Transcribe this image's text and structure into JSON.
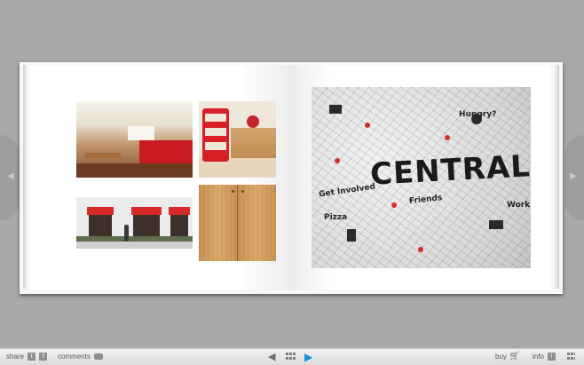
{
  "toolbar": {
    "share_label": "share",
    "comments_label": "comments",
    "buy_label": "buy",
    "info_label": "info",
    "twitter_glyph": "t",
    "facebook_glyph": "f",
    "info_glyph": "i",
    "icons": [
      "twitter-icon",
      "facebook-icon",
      "comment-bubble-icon",
      "previous-page-icon",
      "grid-view-icon",
      "next-page-icon",
      "cart-icon",
      "info-icon",
      "fullscreen-icon"
    ],
    "accent": "#1a8fd8"
  },
  "photo_wall": {
    "main_word": "CENTRAL",
    "tags": [
      "Get Involved",
      "Hungry?",
      "Work",
      "Friends",
      "Pizza"
    ]
  }
}
